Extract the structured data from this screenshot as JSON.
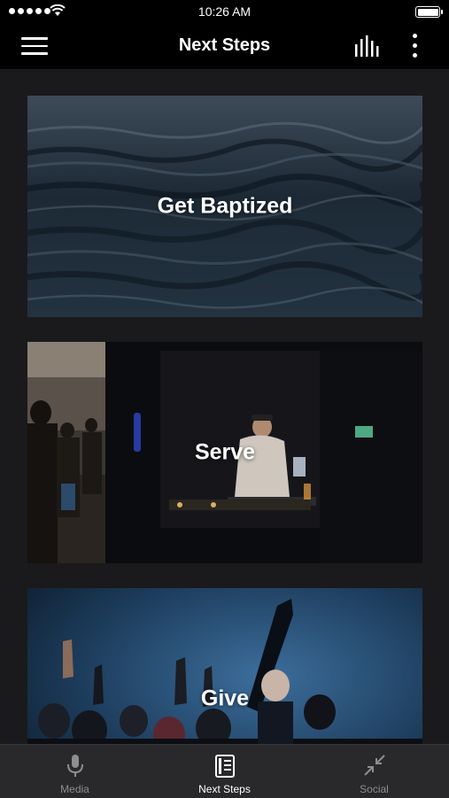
{
  "status_bar": {
    "time": "10:26 AM"
  },
  "nav": {
    "title": "Next Steps"
  },
  "cards": [
    {
      "label": "Get Baptized"
    },
    {
      "label": "Serve"
    },
    {
      "label": "Give"
    }
  ],
  "tabs": [
    {
      "label": "Media",
      "icon": "microphone-icon",
      "active": false
    },
    {
      "label": "Next Steps",
      "icon": "book-icon",
      "active": true
    },
    {
      "label": "Social",
      "icon": "collapse-arrows-icon",
      "active": false
    }
  ],
  "colors": {
    "bar_background": "#000000",
    "content_background": "#1a1a1c",
    "tab_bar_background": "#29292b",
    "tab_inactive": "#8e8e90",
    "tab_active": "#ffffff"
  }
}
